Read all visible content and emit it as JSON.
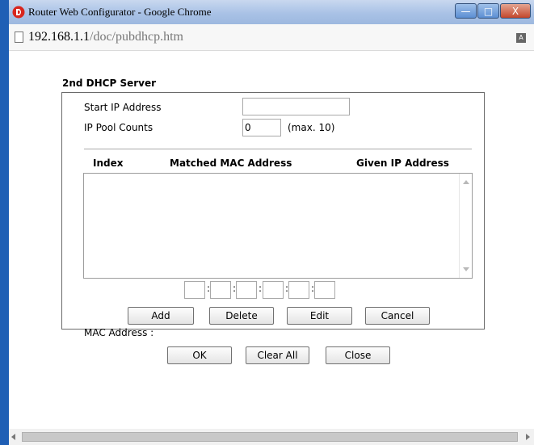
{
  "window": {
    "title": "Router Web Configurator - Google Chrome",
    "controls": {
      "minimize": "—",
      "maximize": "□",
      "close": "X"
    }
  },
  "address_bar": {
    "url_host": "192.168.1.1",
    "url_path": "/doc/pubdhcp.htm"
  },
  "section": {
    "title": "2nd DHCP Server"
  },
  "form": {
    "start_ip_label": "Start IP Address",
    "start_ip_value": "",
    "pool_counts_label": "IP Pool Counts",
    "pool_counts_value": "0",
    "pool_counts_hint": "(max. 10)"
  },
  "table": {
    "headers": [
      "Index",
      "Matched MAC Address",
      "Given IP Address"
    ],
    "rows": []
  },
  "mac": {
    "label": "MAC Address :",
    "separator": ":",
    "octets": [
      "",
      "",
      "",
      "",
      "",
      ""
    ]
  },
  "list_buttons": {
    "add": "Add",
    "delete": "Delete",
    "edit": "Edit",
    "cancel": "Cancel"
  },
  "dialog_buttons": {
    "ok": "OK",
    "clear_all": "Clear All",
    "close": "Close"
  },
  "icons": {
    "app": "vigor-logo-icon",
    "page": "page-icon",
    "translate": "translate-icon"
  },
  "colors": {
    "titlebar": "#a9c2e6",
    "close_button": "#c3472c",
    "side_strip": "#1f5fb5"
  }
}
